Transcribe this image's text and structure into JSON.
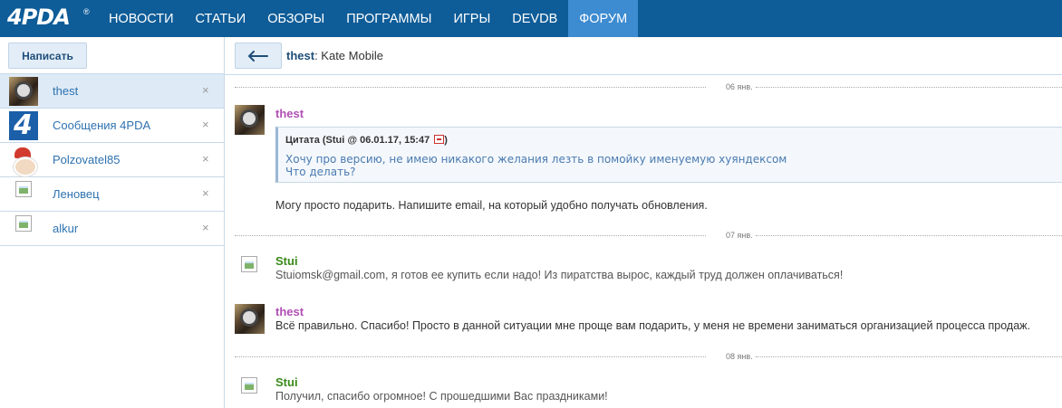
{
  "logo": {
    "text": "4PDA",
    "mark": "®"
  },
  "nav": [
    {
      "label": "НОВОСТИ"
    },
    {
      "label": "СТАТЬИ"
    },
    {
      "label": "ОБЗОРЫ"
    },
    {
      "label": "ПРОГРАММЫ"
    },
    {
      "label": "ИГРЫ"
    },
    {
      "label": "DEVDB"
    },
    {
      "label": "ФОРУМ",
      "active": true
    }
  ],
  "sidebar": {
    "compose_label": "Написать",
    "contacts": [
      {
        "name": "thest",
        "avatar": "cat-avatar",
        "active": true
      },
      {
        "name": "Сообщения 4PDA",
        "avatar": "4pda-avatar"
      },
      {
        "name": "Polzovatel85",
        "avatar": "santa-avatar"
      },
      {
        "name": "Леновец",
        "avatar": "broken-image-icon"
      },
      {
        "name": "alkur",
        "avatar": "broken-image-icon"
      }
    ],
    "close_glyph": "×"
  },
  "conversation": {
    "back_icon": "arrow-left-icon",
    "user": "thest",
    "separator": ": ",
    "subject": "Kate Mobile"
  },
  "messages": {
    "dates": [
      "06 янв.",
      "07 янв.",
      "08 янв."
    ],
    "items": [
      {
        "author": "thest",
        "quote": {
          "header": "Цитата (Stui @ 06.01.17, 15:47",
          "close": ")",
          "lines": [
            "Хочу про версию, не имею никакого желания лезть в помойку именуемую хуяндексом",
            "Что делать?"
          ]
        },
        "text": "Могу просто подарить. Напишите email, на который удобно получать обновления."
      },
      {
        "author": "Stui",
        "text": "Stuiomsk@gmail.com, я готов ее купить если надо! Из пиратства вырос, каждый труд должен оплачиваться!"
      },
      {
        "author": "thest",
        "text": "Всё правильно. Спасибо! Просто в данной ситуации мне проще вам подарить, у меня не времени заниматься организацией процесса продаж."
      },
      {
        "author": "Stui",
        "text": "Получил, спасибо огромное! С прошедшими Вас праздниками!"
      }
    ]
  },
  "colors": {
    "nav_bg": "#0e5c98",
    "nav_active": "#3d8bd1",
    "author_thest": "#b04fb3",
    "author_stui": "#3a8a1a",
    "link": "#2e72b0"
  }
}
